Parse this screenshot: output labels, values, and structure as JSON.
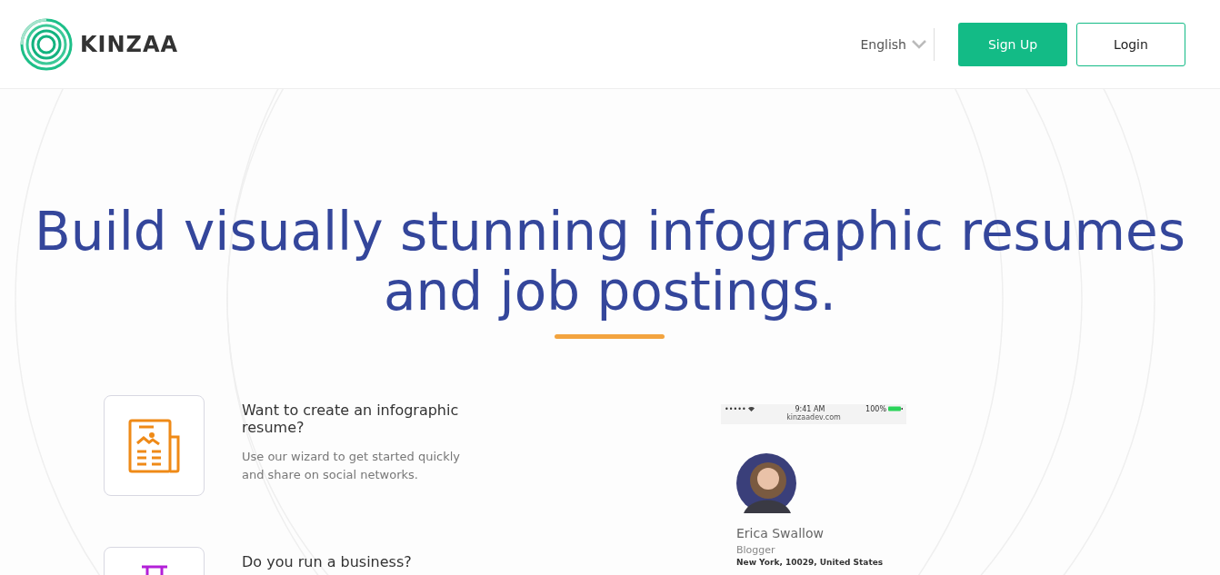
{
  "header": {
    "logo": "KINZAA",
    "language": "English",
    "buttons": [
      {
        "label": "Sign Up",
        "kind": "primary"
      },
      {
        "label": "Login",
        "kind": "outline"
      }
    ]
  },
  "hero": {
    "headline": "Build visually stunning infographic resumes and job postings."
  },
  "features": [
    {
      "kind": "document",
      "title": "Want to create an infographic resume?",
      "description": "Use our wizard to get started quickly and share on social networks."
    },
    {
      "kind": "pillar",
      "title": "Do you run a business?"
    }
  ],
  "phone": {
    "signal": "•••••",
    "time": "9:41 AM",
    "battery": "100%",
    "url": "kinzaadev.com",
    "name": "Erica Swallow",
    "role": "Blogger",
    "location": "New York, 10029, United States"
  }
}
